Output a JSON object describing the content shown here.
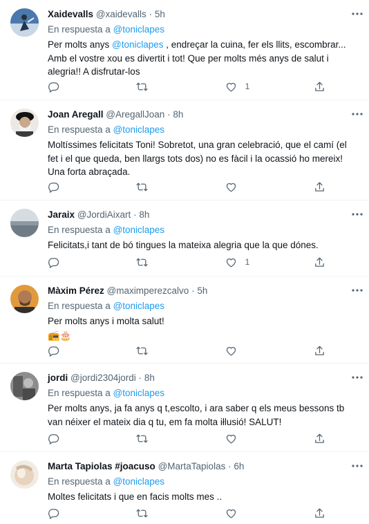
{
  "tweets": [
    {
      "name": "Xaidevalls",
      "handle": "@xaidevalls",
      "time": "5h",
      "reply_prefix": "En respuesta a ",
      "reply_mention": "@toniclapes",
      "text_pre": "Per molts anys ",
      "text_mention": "@toniclapes",
      "text_post": " , endreçar la cuina, fer els llits, escombrar... Amb el vostre xou es divertit i tot! Que per molts més anys de salut i alegria!! A disfrutar-los",
      "emoji": "",
      "like_count": "1"
    },
    {
      "name": "Joan Aregall",
      "handle": "@AregallJoan",
      "time": "8h",
      "reply_prefix": "En respuesta a ",
      "reply_mention": "@toniclapes",
      "text": "Moltíssimes felicitats Toni! Sobretot, una gran celebració, que el camí (el fet i el que queda, ben llargs tots dos) no es fàcil i la ocassió ho mereix! Una forta abraçada.",
      "emoji": "",
      "like_count": ""
    },
    {
      "name": "Jaraix",
      "handle": "@JordiAixart",
      "time": "8h",
      "reply_prefix": "En respuesta a ",
      "reply_mention": "@toniclapes",
      "text": "Felicitats,i tant de bó tingues la mateixa alegria que la que dónes.",
      "emoji": "",
      "like_count": "1"
    },
    {
      "name": "Màxim Pérez",
      "handle": "@maximperezcalvo",
      "time": "5h",
      "reply_prefix": "En respuesta a ",
      "reply_mention": "@toniclapes",
      "text": "Per molts anys i molta salut!",
      "emoji": "📻🎂",
      "like_count": ""
    },
    {
      "name": "jordi",
      "handle": "@jordi2304jordi",
      "time": "8h",
      "reply_prefix": "En respuesta a ",
      "reply_mention": "@toniclapes",
      "text": "Per molts anys, ja fa anys q t,escolto, i ara saber q els meus bessons tb van néixer el mateix dia q tu, em fa molta iłlusió! SALUT!",
      "emoji": "",
      "like_count": ""
    },
    {
      "name": "Marta Tapiolas #joacuso",
      "handle": "@MartaTapiolas",
      "time": "6h",
      "reply_prefix": "En respuesta a ",
      "reply_mention": "@toniclapes",
      "text": "Moltes felicitats i que en facis molts mes ..",
      "emoji": "",
      "like_count": ""
    }
  ],
  "separator": "·",
  "colors": {
    "link": "#1d9bf0",
    "muted": "#536471",
    "text": "#0f1419",
    "divider": "#eff3f4"
  },
  "icons": [
    "more-icon",
    "reply-icon",
    "retweet-icon",
    "like-icon",
    "share-icon"
  ]
}
